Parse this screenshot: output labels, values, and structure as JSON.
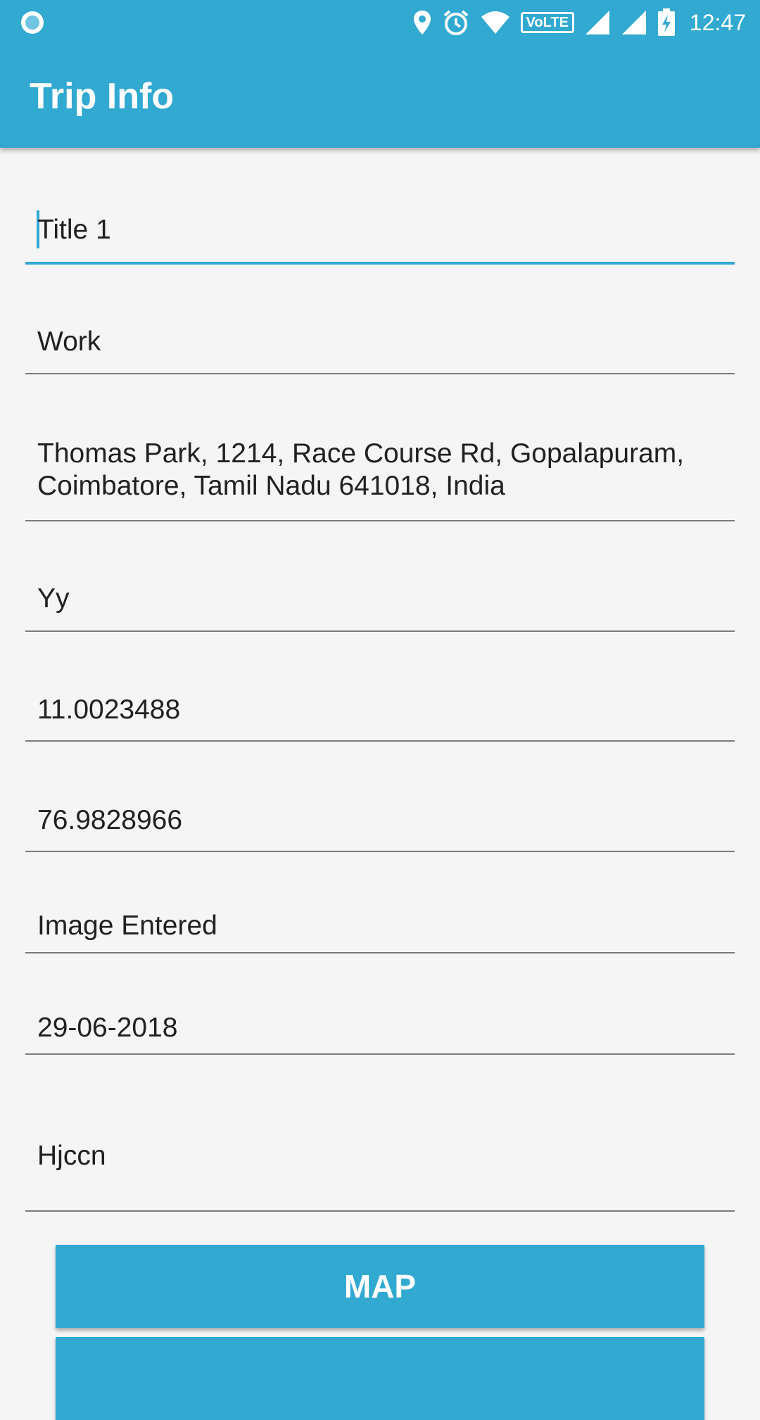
{
  "status_bar": {
    "time": "12:47",
    "icons": [
      "record-icon",
      "location-icon",
      "alarm-icon",
      "wifi-icon",
      "volte-icon",
      "signal-icon",
      "signal-icon",
      "battery-charging-icon"
    ],
    "volte_label": "VoLTE"
  },
  "app_bar": {
    "title": "Trip Info"
  },
  "form": {
    "title": "Title 1",
    "category": "Work",
    "address": "Thomas Park, 1214, Race Course Rd, Gopalapuram, Coimbatore, Tamil Nadu 641018, India",
    "notes": "Yy",
    "latitude": "11.0023488",
    "longitude": "76.9828966",
    "image_status": "Image Entered",
    "date": "29-06-2018",
    "description": "Hjccn"
  },
  "buttons": {
    "map_label": "MAP"
  },
  "colors": {
    "primary": "#31a9d1",
    "background": "#f5f5f5",
    "text": "#212121"
  }
}
